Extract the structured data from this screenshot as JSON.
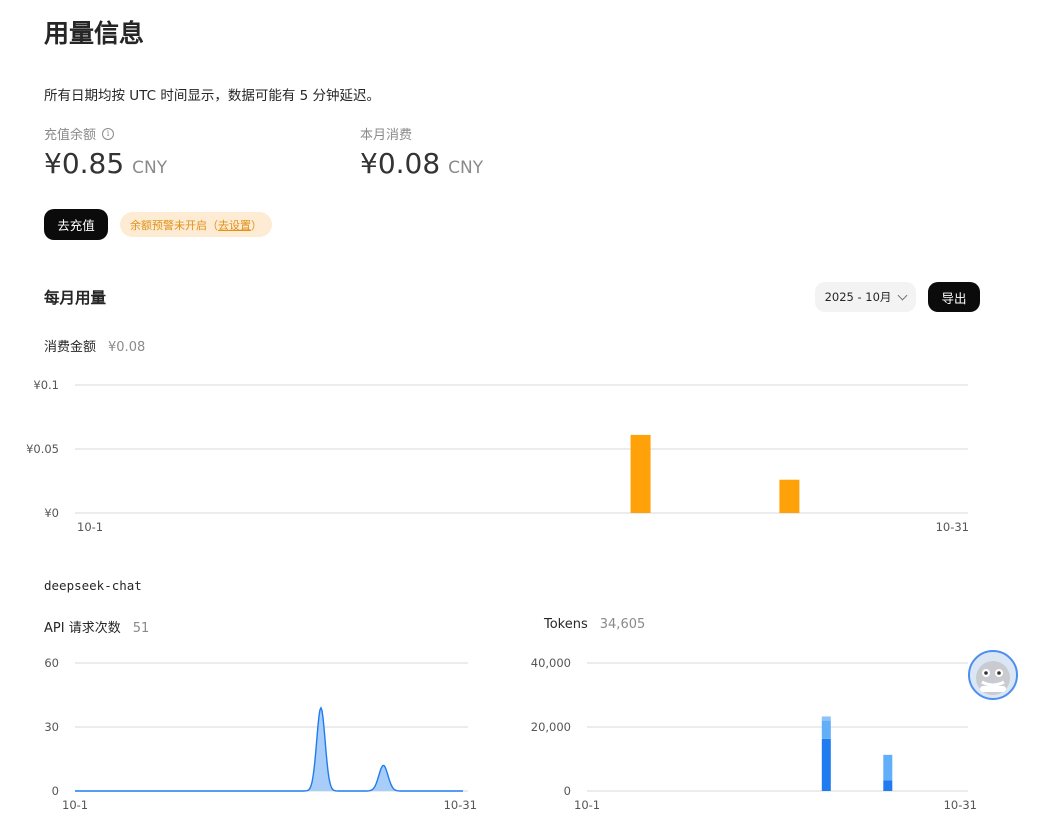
{
  "page": {
    "title": "用量信息",
    "note": "所有日期均按 UTC 时间显示，数据可能有 5 分钟延迟。"
  },
  "balance": {
    "label": "充值余额",
    "amount": "¥0.85",
    "currency": "CNY"
  },
  "month_spend": {
    "label": "本月消费",
    "amount": "¥0.08",
    "currency": "CNY"
  },
  "actions": {
    "recharge_label": "去充值",
    "alert_text": "余额预警未开启（",
    "alert_link": "去设置",
    "alert_close": "）"
  },
  "monthly": {
    "title": "每月用量",
    "month_selected": "2025 - 10月",
    "export_label": "导出"
  },
  "cost_chart_head": {
    "label": "消费金额",
    "value": "¥0.08"
  },
  "model": {
    "name": "deepseek-chat"
  },
  "requests_head": {
    "label": "API 请求次数",
    "value": "51"
  },
  "tokens_head": {
    "label": "Tokens",
    "value": "34,605"
  },
  "colors": {
    "cost_bar": "#ffa20a",
    "requests_line": "#1f7cf0",
    "requests_fill": "#a8cdf8",
    "tokens_dark": "#1f7cf0",
    "tokens_light": "#63aef8",
    "grid": "#d9d9d9"
  },
  "icons": {
    "info": "info-icon",
    "select": "chevron-down-icon",
    "assistant": "assistant-avatar-icon"
  },
  "chart_data": [
    {
      "type": "bar",
      "name": "消费金额",
      "x": [
        1,
        31
      ],
      "xticks": [
        "10-1",
        "10-31"
      ],
      "yticks": [
        "¥0",
        "¥0.05",
        "¥0.1"
      ],
      "ylim": [
        0,
        0.1
      ],
      "points": [
        {
          "day": 20,
          "value": 0.061
        },
        {
          "day": 25,
          "value": 0.026
        }
      ],
      "grid": true
    },
    {
      "type": "area",
      "name": "API 请求次数",
      "xticks": [
        "10-1",
        "10-31"
      ],
      "yticks": [
        "0",
        "30",
        "60"
      ],
      "ylim": [
        0,
        60
      ],
      "points": [
        {
          "day": 20,
          "value": 39
        },
        {
          "day": 25,
          "value": 12
        }
      ],
      "grid": true
    },
    {
      "type": "bar",
      "name": "Tokens",
      "xticks": [
        "10-1",
        "10-31"
      ],
      "yticks": [
        "0",
        "20,000",
        "40,000"
      ],
      "ylim": [
        0,
        40000
      ],
      "points": [
        {
          "day": 20,
          "segments": [
            16300,
            5700,
            1300
          ]
        },
        {
          "day": 25,
          "segments": [
            3300,
            8000
          ]
        }
      ],
      "grid": true
    }
  ]
}
